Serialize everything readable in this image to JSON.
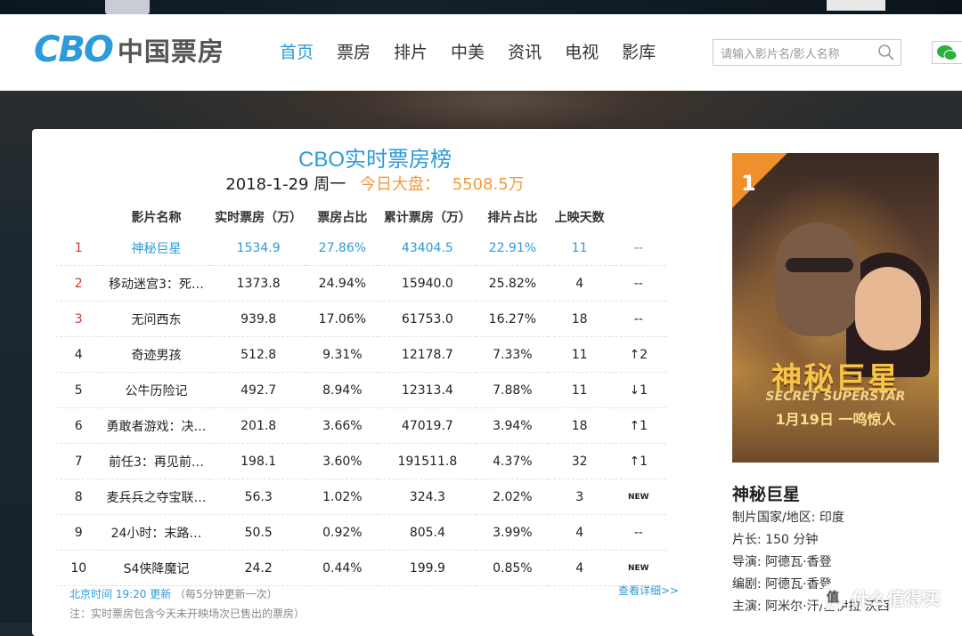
{
  "header": {
    "logo_mark": "CBO",
    "logo_text": "中国票房",
    "nav": [
      "首页",
      "票房",
      "排片",
      "中美",
      "资讯",
      "电视",
      "影库"
    ],
    "search_placeholder": "请输入影片名/影人名称"
  },
  "board": {
    "title": "CBO实时票房榜",
    "date": "2018-1-29 周一",
    "today_label": "今日大盘：",
    "today_total": "5508.5万",
    "columns": [
      "",
      "影片名称",
      "实时票房（万）",
      "票房占比",
      "累计票房（万）",
      "排片占比",
      "上映天数",
      ""
    ],
    "rows": [
      {
        "rank": "1",
        "name": "神秘巨星",
        "realtime": "1534.9",
        "share": "27.86%",
        "cumulative": "43404.5",
        "schedule": "22.91%",
        "days": "11",
        "trend": "--",
        "trend_type": "flat"
      },
      {
        "rank": "2",
        "name": "移动迷宫3：死…",
        "realtime": "1373.8",
        "share": "24.94%",
        "cumulative": "15940.0",
        "schedule": "25.82%",
        "days": "4",
        "trend": "--",
        "trend_type": "flat"
      },
      {
        "rank": "3",
        "name": "无问西东",
        "realtime": "939.8",
        "share": "17.06%",
        "cumulative": "61753.0",
        "schedule": "16.27%",
        "days": "18",
        "trend": "--",
        "trend_type": "flat"
      },
      {
        "rank": "4",
        "name": "奇迹男孩",
        "realtime": "512.8",
        "share": "9.31%",
        "cumulative": "12178.7",
        "schedule": "7.33%",
        "days": "11",
        "trend": "↑2",
        "trend_type": "up"
      },
      {
        "rank": "5",
        "name": "公牛历险记",
        "realtime": "492.7",
        "share": "8.94%",
        "cumulative": "12313.4",
        "schedule": "7.88%",
        "days": "11",
        "trend": "↓1",
        "trend_type": "down"
      },
      {
        "rank": "6",
        "name": "勇敢者游戏：决…",
        "realtime": "201.8",
        "share": "3.66%",
        "cumulative": "47019.7",
        "schedule": "3.94%",
        "days": "18",
        "trend": "↑1",
        "trend_type": "up"
      },
      {
        "rank": "7",
        "name": "前任3：再见前…",
        "realtime": "198.1",
        "share": "3.60%",
        "cumulative": "191511.8",
        "schedule": "4.37%",
        "days": "32",
        "trend": "↑1",
        "trend_type": "up"
      },
      {
        "rank": "8",
        "name": "麦兵兵之夺宝联…",
        "realtime": "56.3",
        "share": "1.02%",
        "cumulative": "324.3",
        "schedule": "2.02%",
        "days": "3",
        "trend": "NEW",
        "trend_type": "new"
      },
      {
        "rank": "9",
        "name": "24小时：末路…",
        "realtime": "50.5",
        "share": "0.92%",
        "cumulative": "805.4",
        "schedule": "3.99%",
        "days": "4",
        "trend": "--",
        "trend_type": "flat"
      },
      {
        "rank": "10",
        "name": "S4侠降魔记",
        "realtime": "24.2",
        "share": "0.44%",
        "cumulative": "199.9",
        "schedule": "0.85%",
        "days": "4",
        "trend": "NEW",
        "trend_type": "new"
      }
    ],
    "update_time": "北京时间 19:20 更新",
    "update_note": "（每5分钟更新一次）",
    "detail_link": "查看详细>>",
    "footnote": "注：实时票房包含今天未开映场次已售出的票房）"
  },
  "feature": {
    "rank": "1",
    "poster_title": "神秘巨星",
    "poster_subtitle": "SECRET SUPERSTAR",
    "poster_date": "1月19日 一鸣惊人",
    "title": "神秘巨星",
    "meta": [
      "制片国家/地区: 印度",
      "片长: 150 分钟",
      "导演: 阿德瓦·香登",
      "编剧: 阿德瓦·香登",
      "主演: 阿米尔·汗/塞伊拉·沃西"
    ]
  },
  "watermark": "什么值得买",
  "colors": {
    "accent": "#2b9bdb",
    "orange": "#f39a3c",
    "up": "#d0342c",
    "down": "#3bab5a"
  }
}
